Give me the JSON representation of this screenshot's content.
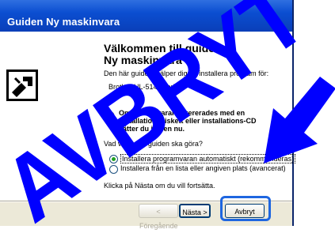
{
  "window": {
    "title": "Guiden Ny maskinvara"
  },
  "content": {
    "heading": "Välkommen till guiden Ny maskinvara",
    "intro": "Den här guiden hjälper dig att installera program för:",
    "device": "Brother HL-5140 series",
    "info_text": "Om maskinvaran levererades med en installationsdiskett eller installations-CD sätter du in den nu.",
    "question": "Vad vill du att guiden ska göra?",
    "option_auto": "Installera programvaran automatiskt (rekommenderas)",
    "option_list": "Installera från en lista eller angiven plats (avancerat)",
    "continue_text": "Klicka på Nästa om du vill fortsätta."
  },
  "buttons": {
    "back": "< Föregående",
    "next": "Nästa >",
    "cancel": "Avbryt"
  },
  "overlay": {
    "text": "AVBRYT",
    "color": "#0000ff"
  }
}
